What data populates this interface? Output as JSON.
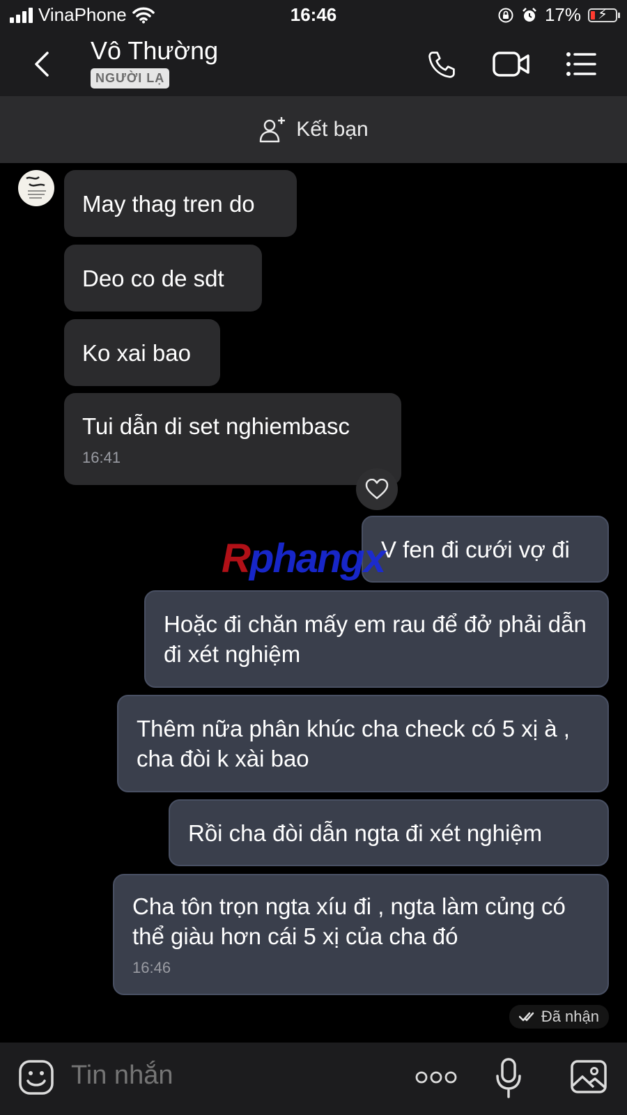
{
  "status_bar": {
    "carrier": "VinaPhone",
    "time": "16:46",
    "battery": "17%"
  },
  "header": {
    "title": "Vô Thường",
    "badge": "NGƯỜI LẠ"
  },
  "add_friend": {
    "label": "Kết bạn"
  },
  "messages": [
    {
      "direction": "incoming",
      "text": "May thag tren do"
    },
    {
      "direction": "incoming",
      "text": "Deo co de sdt"
    },
    {
      "direction": "incoming",
      "text": "Ko xai bao"
    },
    {
      "direction": "incoming",
      "text": "Tui dẫn di set nghiembasc",
      "time": "16:41"
    },
    {
      "direction": "outgoing",
      "text": "V fen đi cưới vợ đi"
    },
    {
      "direction": "outgoing",
      "text": "Hoặc đi chăn mấy em rau để đở phải dẫn đi xét nghiệm"
    },
    {
      "direction": "outgoing",
      "text": "Thêm nữa phân khúc cha check có 5 xị à , cha đòi k xài bao"
    },
    {
      "direction": "outgoing",
      "text": "Rồi cha đòi dẫn ngta đi xét nghiệm"
    },
    {
      "direction": "outgoing",
      "text": "Cha tôn trọn ngta xíu đi , ngta làm củng có thể giàu hơn cái 5 xị của cha đó",
      "time": "16:46"
    }
  ],
  "watermark": {
    "first_letter": "R",
    "rest": "phangx"
  },
  "delivery_status": "Đã nhận",
  "composer": {
    "placeholder": "Tin nhắn"
  },
  "colors": {
    "incoming_bubble": "#2b2b2d",
    "outgoing_bubble": "#3a3f4c",
    "background": "#000000",
    "bar": "#1c1c1e"
  }
}
